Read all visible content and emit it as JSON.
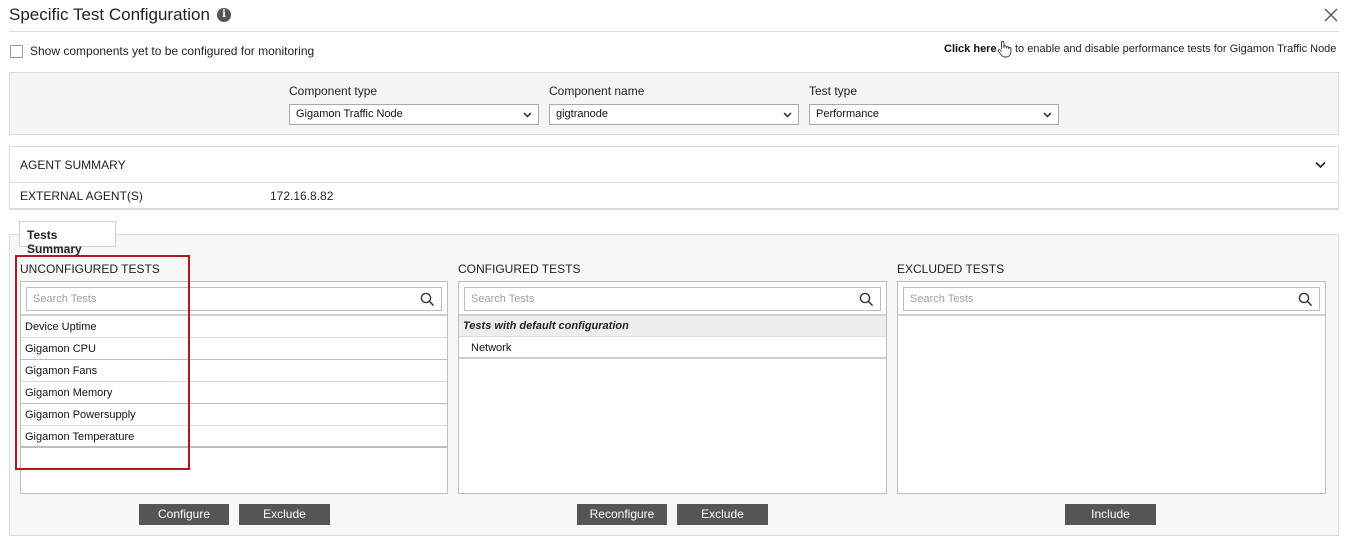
{
  "header": {
    "title": "Specific Test Configuration",
    "info_icon": "i"
  },
  "options": {
    "show_components_label": "Show components yet to be configured for monitoring",
    "show_components_checked": false,
    "click_here_label": "Click here",
    "click_here_rest": "to enable and disable performance tests for Gigamon Traffic Node"
  },
  "filters": {
    "component_type": {
      "label": "Component type",
      "value": "Gigamon Traffic Node"
    },
    "component_name": {
      "label": "Component name",
      "value": "gigtranode"
    },
    "test_type": {
      "label": "Test type",
      "value": "Performance"
    }
  },
  "agent_summary": {
    "title": "AGENT SUMMARY",
    "external_label": "EXTERNAL AGENT(S)",
    "external_value": "172.16.8.82"
  },
  "tests_summary": {
    "tab_label": "Tests Summary",
    "unconfigured": {
      "title": "UNCONFIGURED TESTS",
      "search_placeholder": "Search Tests",
      "items": [
        "Device Uptime",
        "Gigamon CPU",
        "Gigamon Fans",
        "Gigamon Memory",
        "Gigamon Powersupply",
        "Gigamon Temperature"
      ],
      "buttons": {
        "configure": "Configure",
        "exclude": "Exclude"
      }
    },
    "configured": {
      "title": "CONFIGURED TESTS",
      "search_placeholder": "Search Tests",
      "group_label": "Tests with default configuration",
      "items": [
        "Network"
      ],
      "buttons": {
        "reconfigure": "Reconfigure",
        "exclude": "Exclude"
      }
    },
    "excluded": {
      "title": "EXCLUDED TESTS",
      "search_placeholder": "Search Tests",
      "items": [],
      "buttons": {
        "include": "Include"
      }
    }
  },
  "colors": {
    "highlight_border": "#b0191b",
    "button_bg": "#555555",
    "panel_bg": "#f5f5f5"
  }
}
